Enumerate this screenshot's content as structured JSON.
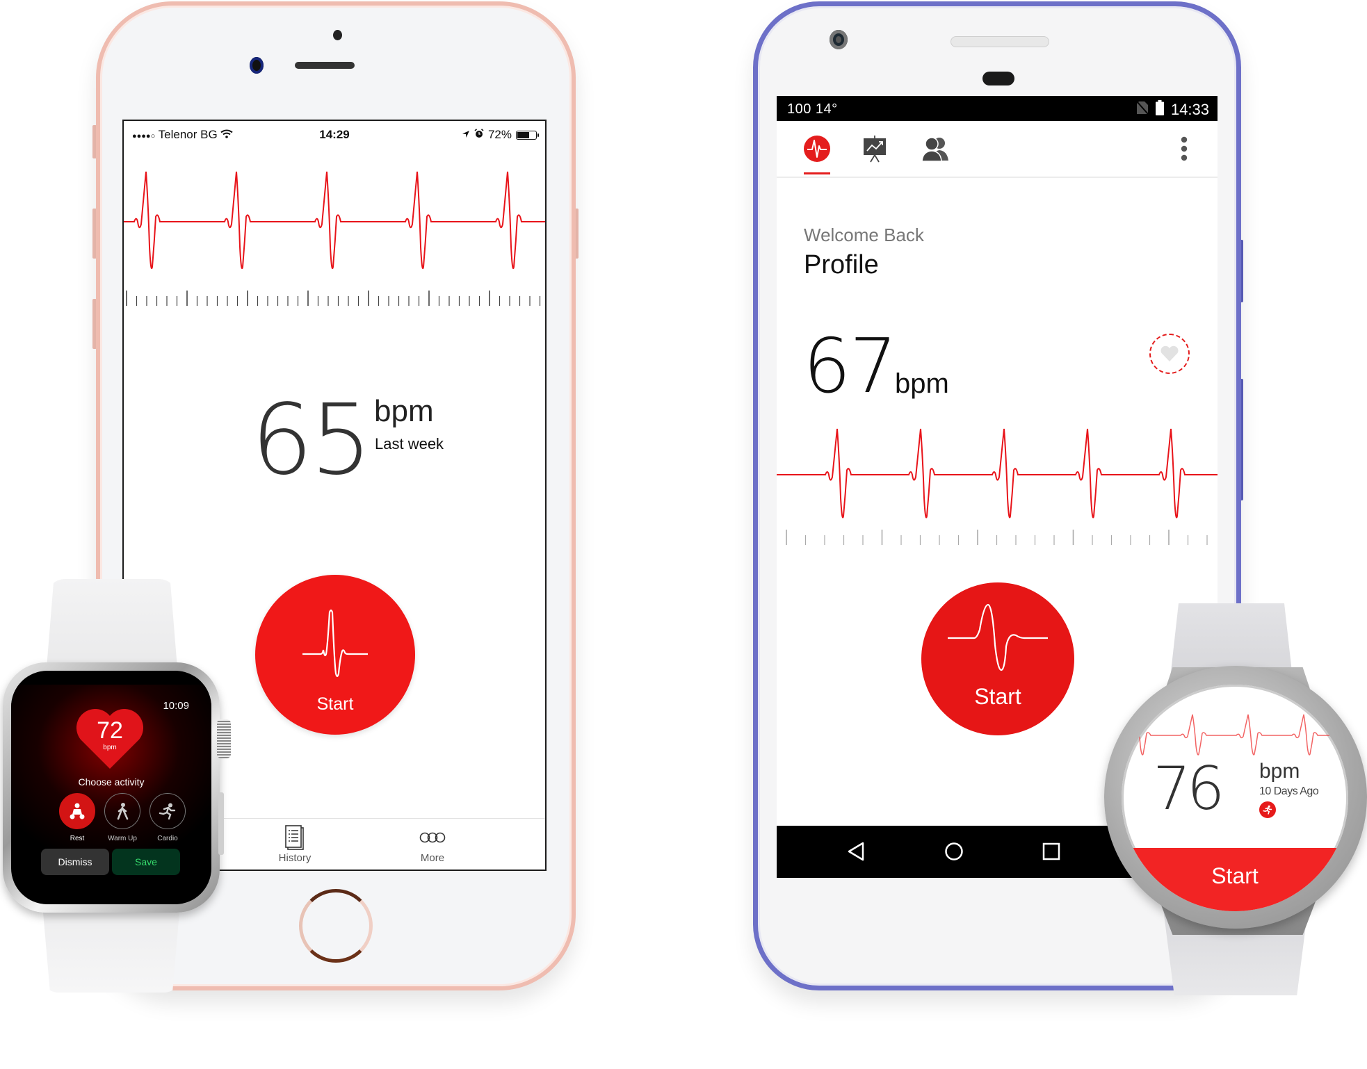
{
  "iphone": {
    "status_bar": {
      "signal": "●●●●○",
      "carrier": "Telenor BG",
      "time": "14:29",
      "battery_percent_label": "72%",
      "battery_level": 0.72
    },
    "ecg": {
      "beats": 5,
      "description": "heart rate waveform"
    },
    "reading": {
      "value": "65",
      "unit": "bpm",
      "subtitle": "Last week"
    },
    "start_button": {
      "label": "Start"
    },
    "tab_bar": {
      "tabs": [
        {
          "label": "History",
          "icon": "history-list-icon"
        },
        {
          "label": "More",
          "icon": "more-rings-icon"
        }
      ]
    }
  },
  "android": {
    "status_bar": {
      "left": "100  14°",
      "time": "14:33"
    },
    "tabs": [
      {
        "icon": "heart-rate-icon",
        "active": true
      },
      {
        "icon": "trend-chart-icon",
        "active": false
      },
      {
        "icon": "users-icon",
        "active": false
      }
    ],
    "overflow_menu": "more-vertical-icon",
    "welcome": "Welcome Back",
    "profile": "Profile",
    "reading": {
      "value": "67",
      "unit": "bpm"
    },
    "ecg": {
      "beats": 5,
      "description": "heart rate waveform"
    },
    "start_button": {
      "label": "Start"
    },
    "nav_bar": [
      "back-icon",
      "home-icon",
      "recents-icon"
    ]
  },
  "apple_watch": {
    "time": "10:09",
    "reading": {
      "value": "72",
      "unit": "bpm"
    },
    "prompt": "Choose activity",
    "activities": [
      {
        "label": "Rest",
        "selected": true
      },
      {
        "label": "Warm Up",
        "selected": false
      },
      {
        "label": "Cardio",
        "selected": false
      }
    ],
    "buttons": {
      "dismiss": "Dismiss",
      "save": "Save"
    }
  },
  "gear_watch": {
    "reading": {
      "value": "76",
      "unit": "bpm",
      "subtitle": "10 Days Ago"
    },
    "start_button": {
      "label": "Start"
    }
  },
  "colors": {
    "accent_red": "#f01818",
    "iphone_frame": "#efbcb0",
    "android_frame": "#6d70c8",
    "save_green": "#35d86b"
  }
}
